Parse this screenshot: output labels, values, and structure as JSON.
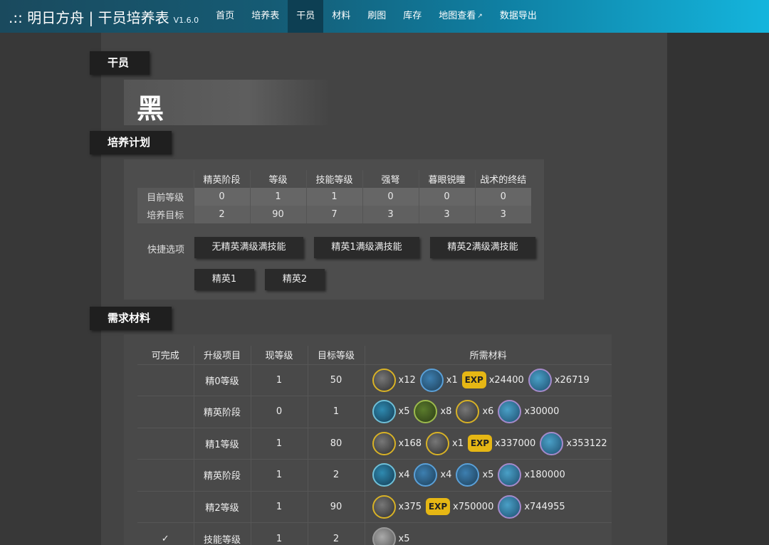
{
  "header": {
    "brand": ".:: 明日方舟 | 干员培养表",
    "version": "V1.6.0",
    "nav": [
      "首页",
      "培养表",
      "干员",
      "材料",
      "刷图",
      "库存",
      "地图查看",
      "数据导出"
    ],
    "active": "干员"
  },
  "sections": {
    "operator": "干员",
    "plan": "培养计划",
    "materials": "需求材料"
  },
  "operator_name": "黑",
  "plan": {
    "columns": [
      "精英阶段",
      "等级",
      "技能等级",
      "强弩",
      "暮眼锐瞳",
      "战术的终结"
    ],
    "current_label": "目前等级",
    "current": [
      "0",
      "1",
      "1",
      "0",
      "0",
      "0"
    ],
    "target_label": "培养目标",
    "target": [
      "2",
      "90",
      "7",
      "3",
      "3",
      "3"
    ]
  },
  "quick": {
    "label": "快捷选项",
    "buttons": [
      "无精英满级满技能",
      "精英1满级满技能",
      "精英2满级满技能",
      "精英1",
      "精英2"
    ]
  },
  "materials_table": {
    "headers": [
      "可完成",
      "升级项目",
      "现等级",
      "目标等级",
      "所需材料"
    ],
    "rows": [
      {
        "done": "",
        "item": "精0等级",
        "cur": "1",
        "tgt": "50",
        "mats": [
          [
            "gold",
            "x12"
          ],
          [
            "blue",
            "x1"
          ],
          [
            "exp",
            "x24400"
          ],
          [
            "purple",
            "x26719"
          ]
        ]
      },
      {
        "done": "",
        "item": "精英阶段",
        "cur": "0",
        "tgt": "1",
        "mats": [
          [
            "teal",
            "x5"
          ],
          [
            "green",
            "x8"
          ],
          [
            "gold",
            "x6"
          ],
          [
            "purple",
            "x30000"
          ]
        ]
      },
      {
        "done": "",
        "item": "精1等级",
        "cur": "1",
        "tgt": "80",
        "mats": [
          [
            "gold",
            "x168"
          ],
          [
            "gold",
            "x1"
          ],
          [
            "exp",
            "x337000"
          ],
          [
            "purple",
            "x353122"
          ]
        ]
      },
      {
        "done": "",
        "item": "精英阶段",
        "cur": "1",
        "tgt": "2",
        "mats": [
          [
            "teal",
            "x4"
          ],
          [
            "blue",
            "x4"
          ],
          [
            "blue",
            "x5"
          ],
          [
            "purple",
            "x180000"
          ]
        ]
      },
      {
        "done": "",
        "item": "精2等级",
        "cur": "1",
        "tgt": "90",
        "mats": [
          [
            "gold",
            "x375"
          ],
          [
            "exp",
            "x750000"
          ],
          [
            "purple",
            "x744955"
          ]
        ]
      },
      {
        "done": "✓",
        "item": "技能等级",
        "cur": "1",
        "tgt": "2",
        "mats": [
          [
            "gray",
            "x5"
          ]
        ]
      }
    ]
  }
}
